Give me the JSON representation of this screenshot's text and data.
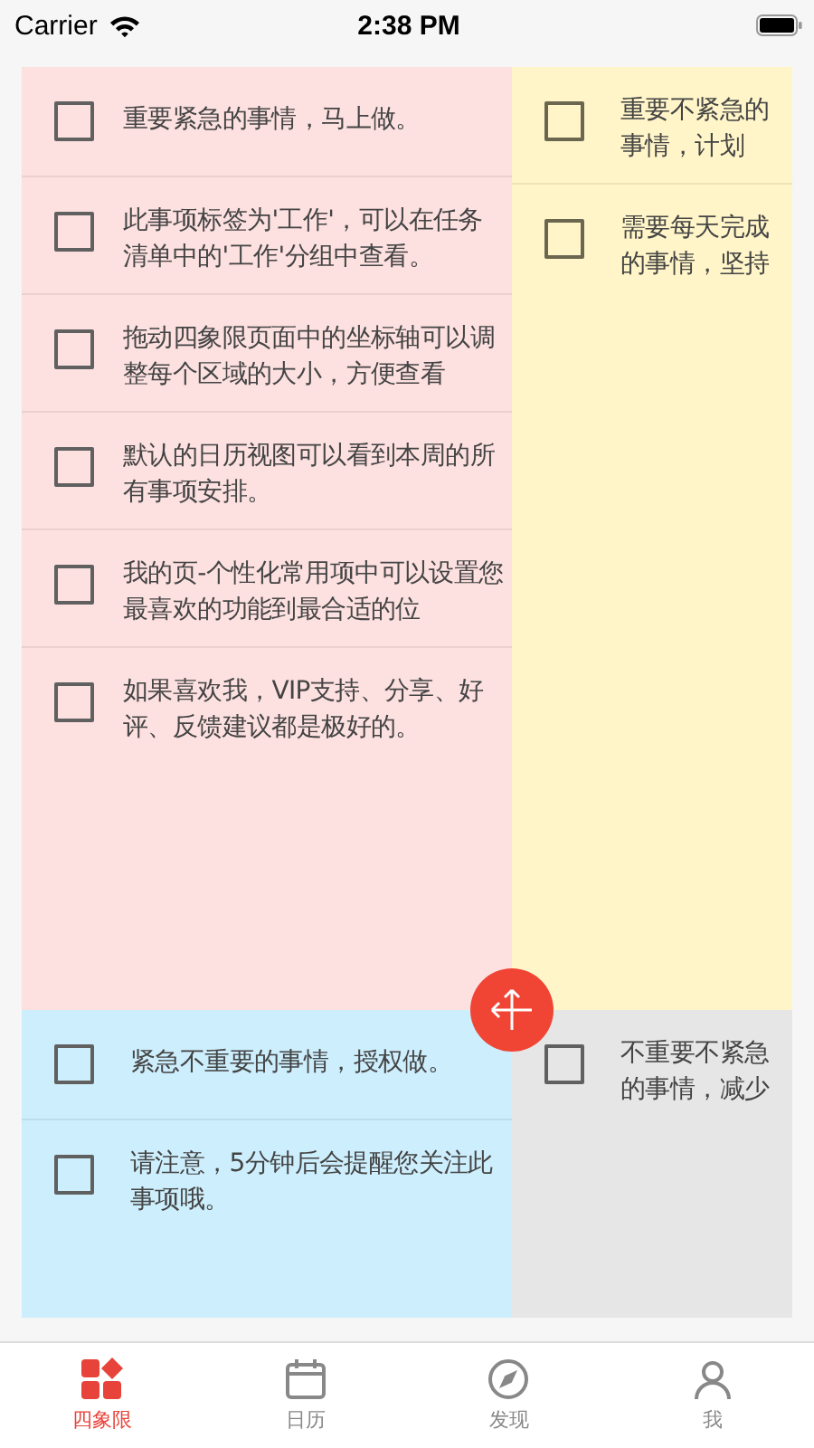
{
  "status_bar": {
    "carrier": "Carrier",
    "time": "2:38 PM"
  },
  "quadrants": [
    {
      "color": "#fde0e0",
      "items": [
        {
          "text": "重要紧急的事情，马上做。",
          "checked": false
        },
        {
          "text": "此事项标签为'工作'，可以在任务清单中的'工作'分组中查看。",
          "checked": false
        },
        {
          "text": "拖动四象限页面中的坐标轴可以调整每个区域的大小，方便查看",
          "checked": false
        },
        {
          "text": "默认的日历视图可以看到本周的所有事项安排。",
          "checked": false
        },
        {
          "text": "我的页-个性化常用项中可以设置您最喜欢的功能到最合适的位",
          "checked": false
        },
        {
          "text": "如果喜欢我，VIP支持、分享、好评、反馈建议都是极好的。",
          "checked": false
        }
      ]
    },
    {
      "color": "#fff5c8",
      "items": [
        {
          "text": "重要不紧急的事情，计划",
          "checked": false
        },
        {
          "text": "需要每天完成的事情，坚持",
          "checked": false
        }
      ]
    },
    {
      "color": "#cdeefc",
      "items": [
        {
          "text": "紧急不重要的事情，授权做。",
          "checked": false
        },
        {
          "text": "请注意，5分钟后会提醒您关注此事项哦。",
          "checked": false
        }
      ]
    },
    {
      "color": "#e6e6e6",
      "items": [
        {
          "text": "不重要不紧急的事情，减少",
          "checked": false
        }
      ]
    }
  ],
  "tabs": [
    {
      "label": "四象限",
      "selected": true
    },
    {
      "label": "日历",
      "selected": false
    },
    {
      "label": "发现",
      "selected": false
    },
    {
      "label": "我",
      "selected": false
    }
  ]
}
